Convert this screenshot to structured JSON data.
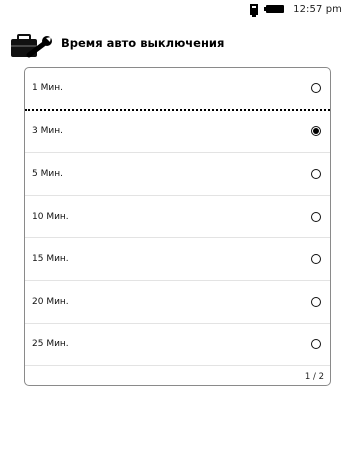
{
  "status_bar": {
    "time": "12:57 pm",
    "battery_icon": "battery-icon",
    "notification_icon": "bookmark-flag-icon"
  },
  "header": {
    "icon": "wrench-toolbox-icon",
    "title": "Время авто выключения"
  },
  "options": [
    {
      "label": "1 Мин.",
      "selected": false
    },
    {
      "label": "3 Мин.",
      "selected": true
    },
    {
      "label": "5 Мин.",
      "selected": false
    },
    {
      "label": "10 Мин.",
      "selected": false
    },
    {
      "label": "15 Мин.",
      "selected": false
    },
    {
      "label": "20 Мин.",
      "selected": false
    },
    {
      "label": "25 Мин.",
      "selected": false
    }
  ],
  "pager": {
    "text": "1 / 2"
  }
}
